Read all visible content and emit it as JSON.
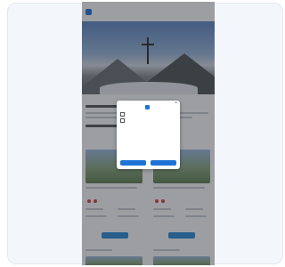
{
  "app": {
    "brand": ""
  },
  "modal": {
    "brand": "",
    "close_glyph": "×",
    "title": "",
    "options": [
      "",
      ""
    ],
    "fine_print": "",
    "buttons": [
      "",
      ""
    ]
  },
  "colors": {
    "accent": "#1f73d6",
    "button": "#2a8bd8",
    "overlay": "rgba(35,40,48,0.45)"
  },
  "icons": [
    "logo-icon",
    "close-icon",
    "checkbox-icon",
    "rating-icon"
  ]
}
